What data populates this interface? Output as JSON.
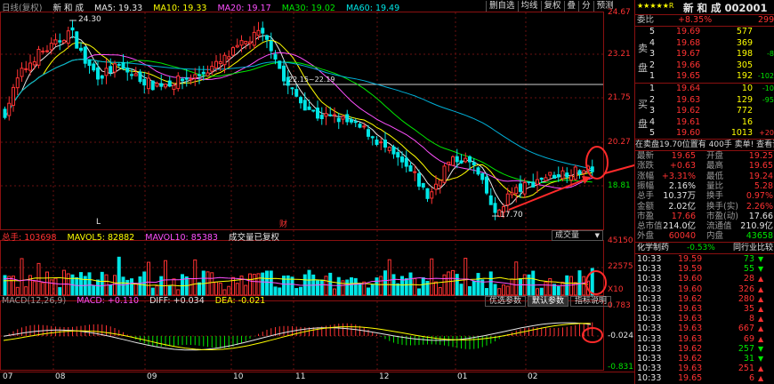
{
  "chart": {
    "legend": {
      "label": "日线(复权)",
      "name": "新 和 成",
      "ma5": "MA5: 19.33",
      "ma10": "MA10: 19.33",
      "ma20": "MA20: 19.17",
      "ma30": "MA30: 19.02",
      "ma60": "MA60: 19.49"
    },
    "toolbar": [
      "删自选",
      "均线",
      "复权",
      "叠",
      "分",
      "预测"
    ],
    "price_ticks": [
      "24.67",
      "23.21",
      "21.75",
      "20.27",
      "18.81"
    ],
    "annotations": {
      "high": "24.30",
      "low": "17.70",
      "range_label": "22.15~22.19",
      "event_l": "L",
      "event_cai": "财"
    },
    "volume": {
      "legend_total": "总手: 103698",
      "legend_mavol5": "MAVOL5: 82882",
      "legend_mavol10": "MAVOL10: 85383",
      "legend_note": "成交量已复权",
      "selector": "成交量",
      "ticks": [
        "45150",
        "22575",
        "X10"
      ]
    },
    "macd": {
      "legend_title": "MACD(12,26,9)",
      "legend_macd": "MACD: +0.110",
      "legend_diff": "DIFF: +0.034",
      "legend_dea": "DEA: -0.021",
      "buttons": [
        "优选参数",
        "默认参数",
        "指标说明"
      ],
      "ticks": [
        "0.783",
        "-0.024",
        "-0.831"
      ]
    },
    "months": [
      "07",
      "08",
      "09",
      "10",
      "11",
      "12",
      "01",
      "02"
    ]
  },
  "quote": {
    "title_prefix": "★★★★★R",
    "title": "新 和 成 002001",
    "webi_label": "委比",
    "webi_value": "+8.35%",
    "webi_right": "299",
    "sell_label": "卖盘",
    "buy_label": "买盘",
    "asks": [
      {
        "level": "5",
        "price": "19.69",
        "vol": "577",
        "chg": ""
      },
      {
        "level": "4",
        "price": "19.68",
        "vol": "369",
        "chg": ""
      },
      {
        "level": "3",
        "price": "19.67",
        "vol": "198",
        "chg": "-8"
      },
      {
        "level": "2",
        "price": "19.66",
        "vol": "305",
        "chg": ""
      },
      {
        "level": "1",
        "price": "19.65",
        "vol": "192",
        "chg": "-102"
      }
    ],
    "bids": [
      {
        "level": "1",
        "price": "19.64",
        "vol": "10",
        "chg": "-10"
      },
      {
        "level": "2",
        "price": "19.63",
        "vol": "129",
        "chg": "-95"
      },
      {
        "level": "3",
        "price": "19.62",
        "vol": "772",
        "chg": ""
      },
      {
        "level": "4",
        "price": "19.61",
        "vol": "16",
        "chg": ""
      },
      {
        "level": "5",
        "price": "19.60",
        "vol": "1013",
        "chg": "+20"
      }
    ],
    "info_bar": "在卖盘19.70位置有  400手  卖单! 查看详细",
    "stats": [
      {
        "l1": "最新",
        "v1": "19.65",
        "l2": "开盘",
        "v2": "19.25"
      },
      {
        "l1": "涨跌",
        "v1": "+0.63",
        "l2": "最高",
        "v2": "19.65"
      },
      {
        "l1": "涨幅",
        "v1": "+3.31%",
        "l2": "最低",
        "v2": "19.24"
      },
      {
        "l1": "振幅",
        "v1": "2.16%",
        "l2": "量比",
        "v2": "5.28"
      },
      {
        "l1": "总手",
        "v1": "10.37万",
        "l2": "换手",
        "v2": "0.97%"
      },
      {
        "l1": "金额",
        "v1": "2.02亿",
        "l2": "换手(实)",
        "v2": "2.26%"
      },
      {
        "l1": "市盈",
        "v1": "17.66",
        "l2": "市盈(动)",
        "v2": "17.66"
      },
      {
        "l1": "总市值",
        "v1": "214.0亿",
        "l2": "流通值",
        "v2": "210.9亿"
      },
      {
        "l1": "外盘",
        "v1": "60040",
        "l2": "内盘",
        "v2": "43658"
      }
    ],
    "sector": {
      "name": "化学制药",
      "change": "-0.53%",
      "compare": "同行业比较"
    },
    "ticks": [
      {
        "time": "10:33",
        "price": "19.59",
        "vol": "73",
        "dir": "down"
      },
      {
        "time": "10:33",
        "price": "19.59",
        "vol": "55",
        "dir": "down"
      },
      {
        "time": "10:33",
        "price": "19.60",
        "vol": "28",
        "dir": "up"
      },
      {
        "time": "10:33",
        "price": "19.60",
        "vol": "326",
        "dir": "up"
      },
      {
        "time": "10:33",
        "price": "19.62",
        "vol": "280",
        "dir": "up"
      },
      {
        "time": "10:33",
        "price": "19.63",
        "vol": "35",
        "dir": "up"
      },
      {
        "time": "10:33",
        "price": "19.63",
        "vol": "8",
        "dir": "up"
      },
      {
        "time": "10:33",
        "price": "19.63",
        "vol": "667",
        "dir": "up"
      },
      {
        "time": "10:33",
        "price": "19.63",
        "vol": "69",
        "dir": "up"
      },
      {
        "time": "10:33",
        "price": "19.62",
        "vol": "257",
        "dir": "down"
      },
      {
        "time": "10:33",
        "price": "19.62",
        "vol": "31",
        "dir": "down"
      },
      {
        "time": "10:33",
        "price": "19.63",
        "vol": "251",
        "dir": "up"
      },
      {
        "time": "10:33",
        "price": "19.65",
        "vol": "6",
        "dir": "up"
      }
    ]
  },
  "colors": {
    "up": "#ff3232",
    "down": "#00e6e6",
    "ma5": "#e6e6e6",
    "ma10": "#ffff00",
    "ma20": "#ff50ff",
    "ma30": "#00e600",
    "ma60": "#00b0d8",
    "grid": "#8a1010"
  }
}
